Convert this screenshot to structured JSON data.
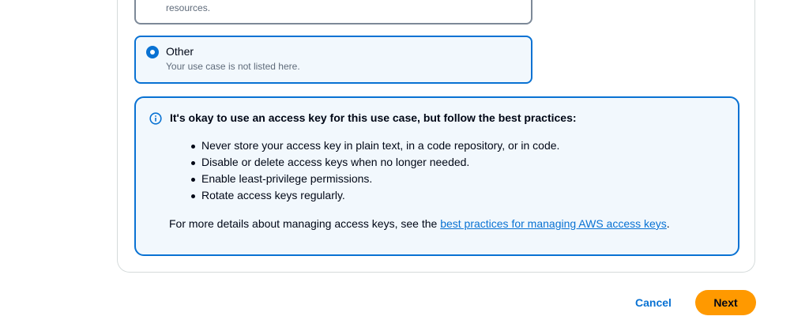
{
  "previous_option": {
    "description_tail": "resources."
  },
  "other_option": {
    "title": "Other",
    "description": "Your use case is not listed here.",
    "selected": true
  },
  "alert": {
    "icon": "info-icon",
    "heading": "It's okay to use an access key for this use case, but follow the best practices:",
    "practices": [
      "Never store your access key in plain text, in a code repository, or in code.",
      "Disable or delete access keys when no longer needed.",
      "Enable least-privilege permissions.",
      "Rotate access keys regularly."
    ],
    "more_details_prefix": "For more details about managing access keys, see the ",
    "more_details_link": "best practices for managing AWS access keys",
    "more_details_suffix": "."
  },
  "footer": {
    "cancel_label": "Cancel",
    "next_label": "Next"
  },
  "colors": {
    "accent": "#0972d3",
    "primary_button": "#ff9900",
    "alert_background": "#f2f8fd"
  }
}
